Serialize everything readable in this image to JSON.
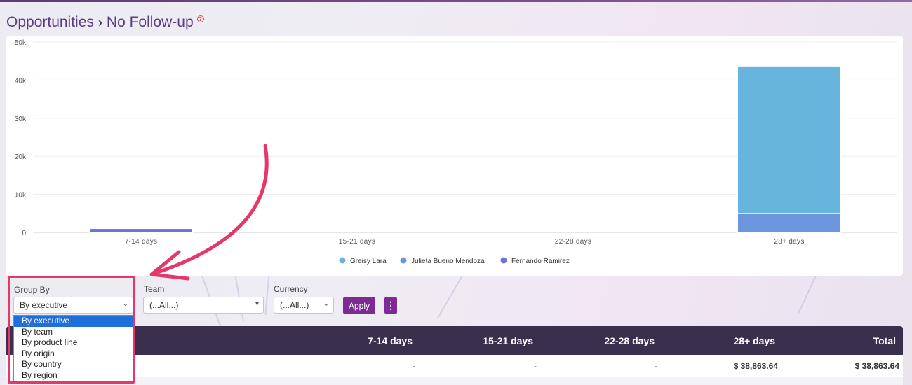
{
  "breadcrumb": {
    "section": "Opportunities",
    "page": "No Follow-up"
  },
  "colors": {
    "accent": "#7d2a94",
    "highlight": "#e6376b",
    "header_bg": "#3b2f4e"
  },
  "chart_data": {
    "type": "bar",
    "stacked": true,
    "categories": [
      "7-14 days",
      "15-21 days",
      "22-28 days",
      "28+ days"
    ],
    "series": [
      {
        "name": "Greisy Lara",
        "color": "#67b5dc",
        "values": [
          0,
          0,
          0,
          38500
        ]
      },
      {
        "name": "Julieta Bueno Mendoza",
        "color": "#6b95dc",
        "values": [
          0,
          0,
          0,
          5000
        ]
      },
      {
        "name": "Fernando Ramirez",
        "color": "#6b74d6",
        "values": [
          1000,
          0,
          0,
          0
        ]
      }
    ],
    "ylim": [
      0,
      50000
    ],
    "yticks": [
      "0",
      "10k",
      "20k",
      "30k",
      "40k",
      "50k"
    ],
    "grid": true,
    "legend_position": "bottom"
  },
  "filters": {
    "group_by": {
      "label": "Group By",
      "value": "By executive"
    },
    "team": {
      "label": "Team",
      "value": "(...All...)"
    },
    "currency": {
      "label": "Currency",
      "value": "(...All...)"
    },
    "apply_label": "Apply",
    "more_icon": "vertical-dots-icon"
  },
  "group_by_options": [
    "By executive",
    "By team",
    "By product line",
    "By origin",
    "By country",
    "By region"
  ],
  "table": {
    "columns": [
      "7-14 days",
      "15-21 days",
      "22-28 days",
      "28+ days",
      "Total"
    ],
    "rows": [
      [
        "-",
        "-",
        "-",
        "$ 38,863.64",
        "$ 38,863.64"
      ]
    ]
  }
}
